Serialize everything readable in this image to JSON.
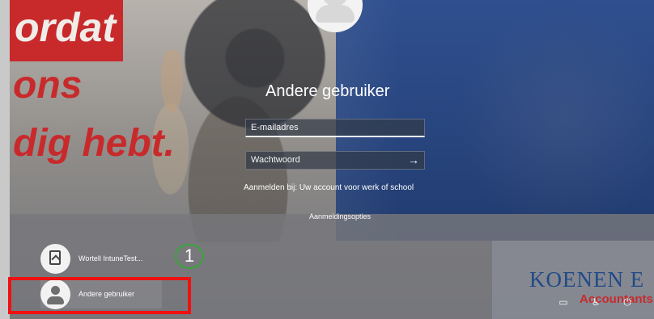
{
  "login": {
    "title": "Andere gebruiker",
    "email_placeholder": "E-mailadres",
    "password_placeholder": "Wachtwoord",
    "helper_text": "Aanmelden bij: Uw account voor werk of school",
    "options_link": "Aanmeldingsopties",
    "submit_icon": "arrow-right-icon"
  },
  "background": {
    "red_text_lines": [
      "ordat",
      "ons",
      "dig hebt."
    ],
    "brand_name": "KOENEN E",
    "brand_subtitle": "Accountants"
  },
  "users": [
    {
      "label": "Wortell IntuneTest...",
      "icon": "badge-avatar-icon"
    },
    {
      "label": "Andere gebruiker",
      "icon": "person-avatar-icon"
    }
  ],
  "annotation": {
    "step_number": "1",
    "highlight_color": "#ef1010",
    "step_color": "#39a53b"
  },
  "system_icons": [
    {
      "name": "network-icon"
    },
    {
      "name": "accessibility-icon"
    },
    {
      "name": "power-icon"
    }
  ],
  "colors": {
    "blue_panel": "#28457f",
    "red_brand": "#c82a2c",
    "brand_blue": "#204a86"
  }
}
